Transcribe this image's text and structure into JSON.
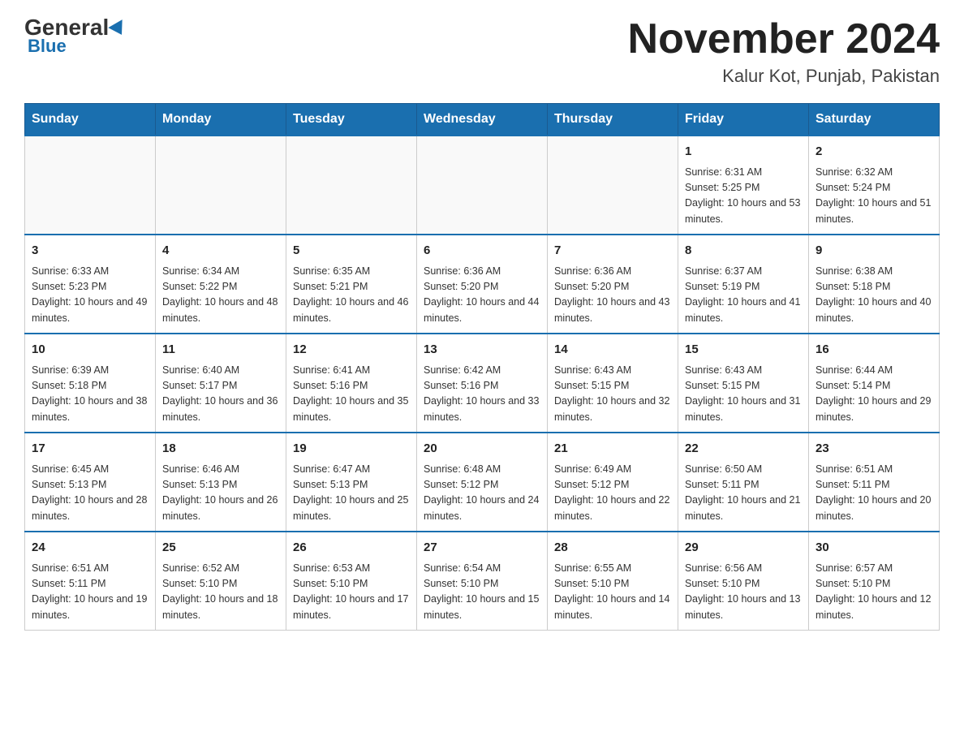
{
  "logo": {
    "general": "General",
    "blue": "Blue"
  },
  "title": "November 2024",
  "subtitle": "Kalur Kot, Punjab, Pakistan",
  "weekdays": [
    "Sunday",
    "Monday",
    "Tuesday",
    "Wednesday",
    "Thursday",
    "Friday",
    "Saturday"
  ],
  "weeks": [
    [
      {
        "day": "",
        "info": ""
      },
      {
        "day": "",
        "info": ""
      },
      {
        "day": "",
        "info": ""
      },
      {
        "day": "",
        "info": ""
      },
      {
        "day": "",
        "info": ""
      },
      {
        "day": "1",
        "info": "Sunrise: 6:31 AM\nSunset: 5:25 PM\nDaylight: 10 hours and 53 minutes."
      },
      {
        "day": "2",
        "info": "Sunrise: 6:32 AM\nSunset: 5:24 PM\nDaylight: 10 hours and 51 minutes."
      }
    ],
    [
      {
        "day": "3",
        "info": "Sunrise: 6:33 AM\nSunset: 5:23 PM\nDaylight: 10 hours and 49 minutes."
      },
      {
        "day": "4",
        "info": "Sunrise: 6:34 AM\nSunset: 5:22 PM\nDaylight: 10 hours and 48 minutes."
      },
      {
        "day": "5",
        "info": "Sunrise: 6:35 AM\nSunset: 5:21 PM\nDaylight: 10 hours and 46 minutes."
      },
      {
        "day": "6",
        "info": "Sunrise: 6:36 AM\nSunset: 5:20 PM\nDaylight: 10 hours and 44 minutes."
      },
      {
        "day": "7",
        "info": "Sunrise: 6:36 AM\nSunset: 5:20 PM\nDaylight: 10 hours and 43 minutes."
      },
      {
        "day": "8",
        "info": "Sunrise: 6:37 AM\nSunset: 5:19 PM\nDaylight: 10 hours and 41 minutes."
      },
      {
        "day": "9",
        "info": "Sunrise: 6:38 AM\nSunset: 5:18 PM\nDaylight: 10 hours and 40 minutes."
      }
    ],
    [
      {
        "day": "10",
        "info": "Sunrise: 6:39 AM\nSunset: 5:18 PM\nDaylight: 10 hours and 38 minutes."
      },
      {
        "day": "11",
        "info": "Sunrise: 6:40 AM\nSunset: 5:17 PM\nDaylight: 10 hours and 36 minutes."
      },
      {
        "day": "12",
        "info": "Sunrise: 6:41 AM\nSunset: 5:16 PM\nDaylight: 10 hours and 35 minutes."
      },
      {
        "day": "13",
        "info": "Sunrise: 6:42 AM\nSunset: 5:16 PM\nDaylight: 10 hours and 33 minutes."
      },
      {
        "day": "14",
        "info": "Sunrise: 6:43 AM\nSunset: 5:15 PM\nDaylight: 10 hours and 32 minutes."
      },
      {
        "day": "15",
        "info": "Sunrise: 6:43 AM\nSunset: 5:15 PM\nDaylight: 10 hours and 31 minutes."
      },
      {
        "day": "16",
        "info": "Sunrise: 6:44 AM\nSunset: 5:14 PM\nDaylight: 10 hours and 29 minutes."
      }
    ],
    [
      {
        "day": "17",
        "info": "Sunrise: 6:45 AM\nSunset: 5:13 PM\nDaylight: 10 hours and 28 minutes."
      },
      {
        "day": "18",
        "info": "Sunrise: 6:46 AM\nSunset: 5:13 PM\nDaylight: 10 hours and 26 minutes."
      },
      {
        "day": "19",
        "info": "Sunrise: 6:47 AM\nSunset: 5:13 PM\nDaylight: 10 hours and 25 minutes."
      },
      {
        "day": "20",
        "info": "Sunrise: 6:48 AM\nSunset: 5:12 PM\nDaylight: 10 hours and 24 minutes."
      },
      {
        "day": "21",
        "info": "Sunrise: 6:49 AM\nSunset: 5:12 PM\nDaylight: 10 hours and 22 minutes."
      },
      {
        "day": "22",
        "info": "Sunrise: 6:50 AM\nSunset: 5:11 PM\nDaylight: 10 hours and 21 minutes."
      },
      {
        "day": "23",
        "info": "Sunrise: 6:51 AM\nSunset: 5:11 PM\nDaylight: 10 hours and 20 minutes."
      }
    ],
    [
      {
        "day": "24",
        "info": "Sunrise: 6:51 AM\nSunset: 5:11 PM\nDaylight: 10 hours and 19 minutes."
      },
      {
        "day": "25",
        "info": "Sunrise: 6:52 AM\nSunset: 5:10 PM\nDaylight: 10 hours and 18 minutes."
      },
      {
        "day": "26",
        "info": "Sunrise: 6:53 AM\nSunset: 5:10 PM\nDaylight: 10 hours and 17 minutes."
      },
      {
        "day": "27",
        "info": "Sunrise: 6:54 AM\nSunset: 5:10 PM\nDaylight: 10 hours and 15 minutes."
      },
      {
        "day": "28",
        "info": "Sunrise: 6:55 AM\nSunset: 5:10 PM\nDaylight: 10 hours and 14 minutes."
      },
      {
        "day": "29",
        "info": "Sunrise: 6:56 AM\nSunset: 5:10 PM\nDaylight: 10 hours and 13 minutes."
      },
      {
        "day": "30",
        "info": "Sunrise: 6:57 AM\nSunset: 5:10 PM\nDaylight: 10 hours and 12 minutes."
      }
    ]
  ]
}
